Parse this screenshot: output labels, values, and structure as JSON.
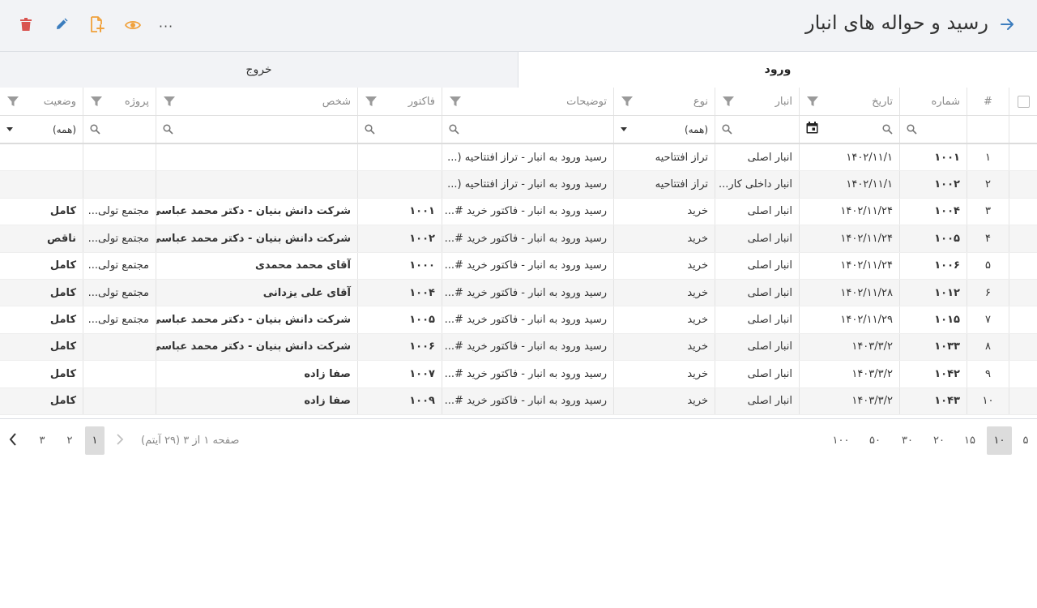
{
  "header": {
    "title": "رسید و حواله های انبار",
    "more_label": "···"
  },
  "colors": {
    "delete": "#d9534f",
    "edit": "#3c7dbe",
    "add": "#f0a13c",
    "view": "#f0a13c",
    "link": "#3c7dbe",
    "complete": "#2b9a6c",
    "incomplete": "#e8953c"
  },
  "tabs": {
    "enter": "ورود",
    "exit": "خروج"
  },
  "columns": {
    "idx": "#",
    "num": "شماره",
    "date": "تاریخ",
    "wh": "انبار",
    "type": "نوع",
    "desc": "توضیحات",
    "inv": "فاکتور",
    "pers": "شخص",
    "proj": "پروژه",
    "stat": "وضعیت"
  },
  "filters": {
    "type": "(همه)",
    "stat": "(همه)"
  },
  "rows": [
    {
      "idx": "۱",
      "num": "۱۰۰۱",
      "date": "۱۴۰۲/۱۱/۱",
      "wh": "انبار اصلی",
      "type": "تراز افتتاحیه",
      "desc": "رسید ورود به انبار - تراز افتتاحیه (...",
      "inv": "",
      "pers": "",
      "proj": "",
      "stat": "",
      "stat_class": ""
    },
    {
      "idx": "۲",
      "num": "۱۰۰۲",
      "date": "۱۴۰۲/۱۱/۱",
      "wh": "انبار داخلی کار...",
      "type": "تراز افتتاحیه",
      "desc": "رسید ورود به انبار - تراز افتتاحیه (...",
      "inv": "",
      "pers": "",
      "proj": "",
      "stat": "",
      "stat_class": ""
    },
    {
      "idx": "۳",
      "num": "۱۰۰۴",
      "date": "۱۴۰۲/۱۱/۲۴",
      "wh": "انبار اصلی",
      "type": "خرید",
      "desc": "رسید ورود به انبار - فاکتور خرید #...",
      "inv": "۱۰۰۱",
      "pers": "شرکت دانش بنیان - دکتر محمد عباسی",
      "proj": "مجتمع تولی...",
      "stat": "کامل",
      "stat_class": "st-ok"
    },
    {
      "idx": "۴",
      "num": "۱۰۰۵",
      "date": "۱۴۰۲/۱۱/۲۴",
      "wh": "انبار اصلی",
      "type": "خرید",
      "desc": "رسید ورود به انبار - فاکتور خرید #...",
      "inv": "۱۰۰۲",
      "pers": "شرکت دانش بنیان - دکتر محمد عباسی",
      "proj": "مجتمع تولی...",
      "stat": "ناقص",
      "stat_class": "st-bad"
    },
    {
      "idx": "۵",
      "num": "۱۰۰۶",
      "date": "۱۴۰۲/۱۱/۲۴",
      "wh": "انبار اصلی",
      "type": "خرید",
      "desc": "رسید ورود به انبار - فاکتور خرید #...",
      "inv": "۱۰۰۰",
      "pers": "آقای محمد محمدی",
      "proj": "مجتمع تولی...",
      "stat": "کامل",
      "stat_class": "st-ok"
    },
    {
      "idx": "۶",
      "num": "۱۰۱۲",
      "date": "۱۴۰۲/۱۱/۲۸",
      "wh": "انبار اصلی",
      "type": "خرید",
      "desc": "رسید ورود به انبار - فاکتور خرید #...",
      "inv": "۱۰۰۴",
      "pers": "آقای علی یزدانی",
      "proj": "مجتمع تولی...",
      "stat": "کامل",
      "stat_class": "st-ok"
    },
    {
      "idx": "۷",
      "num": "۱۰۱۵",
      "date": "۱۴۰۲/۱۱/۲۹",
      "wh": "انبار اصلی",
      "type": "خرید",
      "desc": "رسید ورود به انبار - فاکتور خرید #...",
      "inv": "۱۰۰۵",
      "pers": "شرکت دانش بنیان - دکتر محمد عباسی",
      "proj": "مجتمع تولی...",
      "stat": "کامل",
      "stat_class": "st-ok"
    },
    {
      "idx": "۸",
      "num": "۱۰۳۳",
      "date": "۱۴۰۳/۳/۲",
      "wh": "انبار اصلی",
      "type": "خرید",
      "desc": "رسید ورود به انبار - فاکتور خرید #...",
      "inv": "۱۰۰۶",
      "pers": "شرکت دانش بنیان - دکتر محمد عباسی",
      "proj": "",
      "stat": "کامل",
      "stat_class": "st-ok"
    },
    {
      "idx": "۹",
      "num": "۱۰۴۲",
      "date": "۱۴۰۳/۳/۲",
      "wh": "انبار اصلی",
      "type": "خرید",
      "desc": "رسید ورود به انبار - فاکتور خرید #...",
      "inv": "۱۰۰۷",
      "pers": "صفا زاده",
      "proj": "",
      "stat": "کامل",
      "stat_class": "st-ok"
    },
    {
      "idx": "۱۰",
      "num": "۱۰۴۳",
      "date": "۱۴۰۳/۳/۲",
      "wh": "انبار اصلی",
      "type": "خرید",
      "desc": "رسید ورود به انبار - فاکتور خرید #...",
      "inv": "۱۰۰۹",
      "pers": "صفا زاده",
      "proj": "",
      "stat": "کامل",
      "stat_class": "st-ok"
    }
  ],
  "pager": {
    "info": "صفحه ۱ از ۳ (۲۹ آیتم)",
    "pages": [
      "۱",
      "۲",
      "۳"
    ],
    "current_page": "۱",
    "sizes": [
      "۵",
      "۱۰",
      "۱۵",
      "۲۰",
      "۳۰",
      "۵۰",
      "۱۰۰"
    ],
    "current_size": "۱۰"
  }
}
